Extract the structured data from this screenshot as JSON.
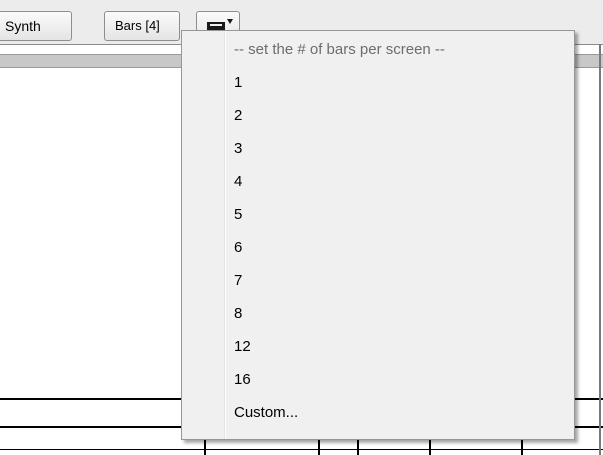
{
  "toolbar": {
    "synth_label": "Synth",
    "bars_label": "Bars [4]",
    "bars_dropdown_icon": "bars-dropdown-icon"
  },
  "menu": {
    "header": "-- set the # of bars per screen --",
    "items": [
      "1",
      "2",
      "3",
      "4",
      "5",
      "6",
      "7",
      "8",
      "12",
      "16",
      "Custom..."
    ]
  }
}
